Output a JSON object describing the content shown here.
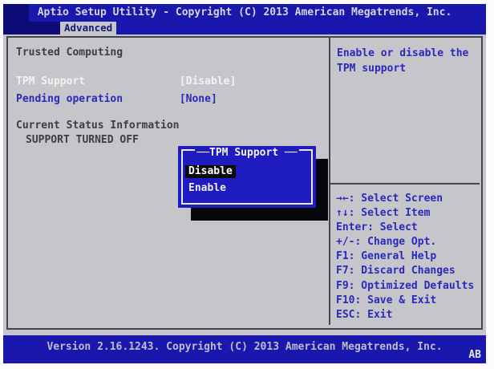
{
  "titlebar": {
    "title": "Aptio Setup Utility - Copyright (C) 2013 American Megatrends, Inc."
  },
  "menubar": {
    "tabs": [
      {
        "label": "Advanced",
        "selected": true
      }
    ]
  },
  "main": {
    "section_title": "Trusted Computing",
    "items": [
      {
        "label": "TPM Support",
        "value": "[Disable]",
        "selected": true
      },
      {
        "label": "Pending operation",
        "value": "[None]",
        "selected": false
      }
    ],
    "status_heading": "Current Status Information",
    "status_value": "SUPPORT TURNED OFF"
  },
  "popup": {
    "title": "TPM Support",
    "options": [
      {
        "label": "Disable",
        "selected": true
      },
      {
        "label": "Enable",
        "selected": false
      }
    ]
  },
  "help_panel": {
    "description": "Enable or disable the TPM support",
    "keys": [
      "→←: Select Screen",
      "↑↓: Select Item",
      "Enter: Select",
      "+/-: Change Opt.",
      "F1: General Help",
      "F7: Discard Changes",
      "F9: Optimized Defaults",
      "F10: Save & Exit",
      "ESC: Exit"
    ]
  },
  "statusbar": {
    "version_text": "Version 2.16.1243. Copyright (C) 2013 American Megatrends, Inc.",
    "corner_label": "AB"
  },
  "colors": {
    "bar_blue": "#1a17ad",
    "popup_blue": "#1e1bbf",
    "panel_gray": "#c6c6ca",
    "text_blue": "#2b29bd",
    "text_dark": "#3e3e42",
    "highlight_black": "#0a0a0a",
    "selected_text": "#f2f2f2"
  }
}
